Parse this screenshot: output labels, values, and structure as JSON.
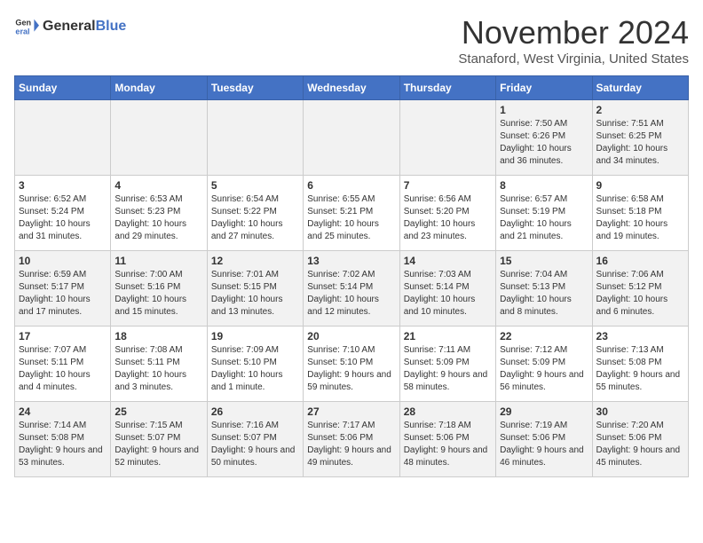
{
  "header": {
    "logo": {
      "general": "General",
      "blue": "Blue"
    },
    "title": "November 2024",
    "subtitle": "Stanaford, West Virginia, United States"
  },
  "weekdays": [
    "Sunday",
    "Monday",
    "Tuesday",
    "Wednesday",
    "Thursday",
    "Friday",
    "Saturday"
  ],
  "weeks": [
    [
      {
        "day": "",
        "sunrise": "",
        "sunset": "",
        "daylight": ""
      },
      {
        "day": "",
        "sunrise": "",
        "sunset": "",
        "daylight": ""
      },
      {
        "day": "",
        "sunrise": "",
        "sunset": "",
        "daylight": ""
      },
      {
        "day": "",
        "sunrise": "",
        "sunset": "",
        "daylight": ""
      },
      {
        "day": "",
        "sunrise": "",
        "sunset": "",
        "daylight": ""
      },
      {
        "day": "1",
        "sunrise": "Sunrise: 7:50 AM",
        "sunset": "Sunset: 6:26 PM",
        "daylight": "Daylight: 10 hours and 36 minutes."
      },
      {
        "day": "2",
        "sunrise": "Sunrise: 7:51 AM",
        "sunset": "Sunset: 6:25 PM",
        "daylight": "Daylight: 10 hours and 34 minutes."
      }
    ],
    [
      {
        "day": "3",
        "sunrise": "Sunrise: 6:52 AM",
        "sunset": "Sunset: 5:24 PM",
        "daylight": "Daylight: 10 hours and 31 minutes."
      },
      {
        "day": "4",
        "sunrise": "Sunrise: 6:53 AM",
        "sunset": "Sunset: 5:23 PM",
        "daylight": "Daylight: 10 hours and 29 minutes."
      },
      {
        "day": "5",
        "sunrise": "Sunrise: 6:54 AM",
        "sunset": "Sunset: 5:22 PM",
        "daylight": "Daylight: 10 hours and 27 minutes."
      },
      {
        "day": "6",
        "sunrise": "Sunrise: 6:55 AM",
        "sunset": "Sunset: 5:21 PM",
        "daylight": "Daylight: 10 hours and 25 minutes."
      },
      {
        "day": "7",
        "sunrise": "Sunrise: 6:56 AM",
        "sunset": "Sunset: 5:20 PM",
        "daylight": "Daylight: 10 hours and 23 minutes."
      },
      {
        "day": "8",
        "sunrise": "Sunrise: 6:57 AM",
        "sunset": "Sunset: 5:19 PM",
        "daylight": "Daylight: 10 hours and 21 minutes."
      },
      {
        "day": "9",
        "sunrise": "Sunrise: 6:58 AM",
        "sunset": "Sunset: 5:18 PM",
        "daylight": "Daylight: 10 hours and 19 minutes."
      }
    ],
    [
      {
        "day": "10",
        "sunrise": "Sunrise: 6:59 AM",
        "sunset": "Sunset: 5:17 PM",
        "daylight": "Daylight: 10 hours and 17 minutes."
      },
      {
        "day": "11",
        "sunrise": "Sunrise: 7:00 AM",
        "sunset": "Sunset: 5:16 PM",
        "daylight": "Daylight: 10 hours and 15 minutes."
      },
      {
        "day": "12",
        "sunrise": "Sunrise: 7:01 AM",
        "sunset": "Sunset: 5:15 PM",
        "daylight": "Daylight: 10 hours and 13 minutes."
      },
      {
        "day": "13",
        "sunrise": "Sunrise: 7:02 AM",
        "sunset": "Sunset: 5:14 PM",
        "daylight": "Daylight: 10 hours and 12 minutes."
      },
      {
        "day": "14",
        "sunrise": "Sunrise: 7:03 AM",
        "sunset": "Sunset: 5:14 PM",
        "daylight": "Daylight: 10 hours and 10 minutes."
      },
      {
        "day": "15",
        "sunrise": "Sunrise: 7:04 AM",
        "sunset": "Sunset: 5:13 PM",
        "daylight": "Daylight: 10 hours and 8 minutes."
      },
      {
        "day": "16",
        "sunrise": "Sunrise: 7:06 AM",
        "sunset": "Sunset: 5:12 PM",
        "daylight": "Daylight: 10 hours and 6 minutes."
      }
    ],
    [
      {
        "day": "17",
        "sunrise": "Sunrise: 7:07 AM",
        "sunset": "Sunset: 5:11 PM",
        "daylight": "Daylight: 10 hours and 4 minutes."
      },
      {
        "day": "18",
        "sunrise": "Sunrise: 7:08 AM",
        "sunset": "Sunset: 5:11 PM",
        "daylight": "Daylight: 10 hours and 3 minutes."
      },
      {
        "day": "19",
        "sunrise": "Sunrise: 7:09 AM",
        "sunset": "Sunset: 5:10 PM",
        "daylight": "Daylight: 10 hours and 1 minute."
      },
      {
        "day": "20",
        "sunrise": "Sunrise: 7:10 AM",
        "sunset": "Sunset: 5:10 PM",
        "daylight": "Daylight: 9 hours and 59 minutes."
      },
      {
        "day": "21",
        "sunrise": "Sunrise: 7:11 AM",
        "sunset": "Sunset: 5:09 PM",
        "daylight": "Daylight: 9 hours and 58 minutes."
      },
      {
        "day": "22",
        "sunrise": "Sunrise: 7:12 AM",
        "sunset": "Sunset: 5:09 PM",
        "daylight": "Daylight: 9 hours and 56 minutes."
      },
      {
        "day": "23",
        "sunrise": "Sunrise: 7:13 AM",
        "sunset": "Sunset: 5:08 PM",
        "daylight": "Daylight: 9 hours and 55 minutes."
      }
    ],
    [
      {
        "day": "24",
        "sunrise": "Sunrise: 7:14 AM",
        "sunset": "Sunset: 5:08 PM",
        "daylight": "Daylight: 9 hours and 53 minutes."
      },
      {
        "day": "25",
        "sunrise": "Sunrise: 7:15 AM",
        "sunset": "Sunset: 5:07 PM",
        "daylight": "Daylight: 9 hours and 52 minutes."
      },
      {
        "day": "26",
        "sunrise": "Sunrise: 7:16 AM",
        "sunset": "Sunset: 5:07 PM",
        "daylight": "Daylight: 9 hours and 50 minutes."
      },
      {
        "day": "27",
        "sunrise": "Sunrise: 7:17 AM",
        "sunset": "Sunset: 5:06 PM",
        "daylight": "Daylight: 9 hours and 49 minutes."
      },
      {
        "day": "28",
        "sunrise": "Sunrise: 7:18 AM",
        "sunset": "Sunset: 5:06 PM",
        "daylight": "Daylight: 9 hours and 48 minutes."
      },
      {
        "day": "29",
        "sunrise": "Sunrise: 7:19 AM",
        "sunset": "Sunset: 5:06 PM",
        "daylight": "Daylight: 9 hours and 46 minutes."
      },
      {
        "day": "30",
        "sunrise": "Sunrise: 7:20 AM",
        "sunset": "Sunset: 5:06 PM",
        "daylight": "Daylight: 9 hours and 45 minutes."
      }
    ]
  ]
}
